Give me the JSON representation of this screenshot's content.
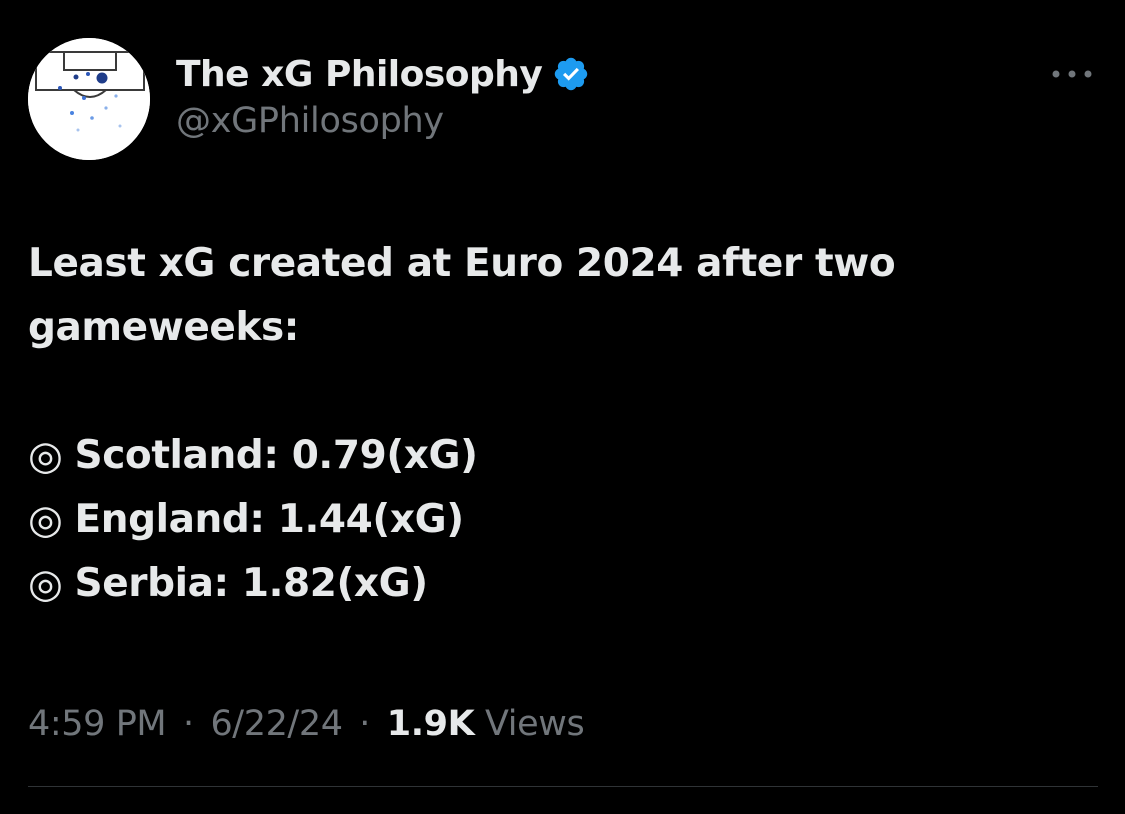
{
  "author": {
    "display_name": "The xG Philosophy",
    "handle": "@xGPhilosophy",
    "avatar_icon": "football-pitch-shotmap-icon",
    "verified_icon": "verified-badge-icon",
    "verified_color": "#1d9bf0"
  },
  "tweet": {
    "intro_line": "Least xG created at Euro 2024 after two gameweeks:",
    "bullet_glyph": "◎",
    "stats": [
      {
        "text": "Scotland: 0.79(xG)"
      },
      {
        "text": "England: 1.44(xG)"
      },
      {
        "text": "Serbia: 1.82(xG)"
      }
    ]
  },
  "meta": {
    "time": "4:59 PM",
    "separator": "·",
    "date": "6/22/24",
    "views_count": "1.9K",
    "views_label": "Views"
  },
  "menu": {
    "icon": "more-options-icon"
  },
  "colors": {
    "background": "#000000",
    "primary_text": "#e7e9ea",
    "secondary_text": "#71767b",
    "divider": "#2f3336"
  }
}
